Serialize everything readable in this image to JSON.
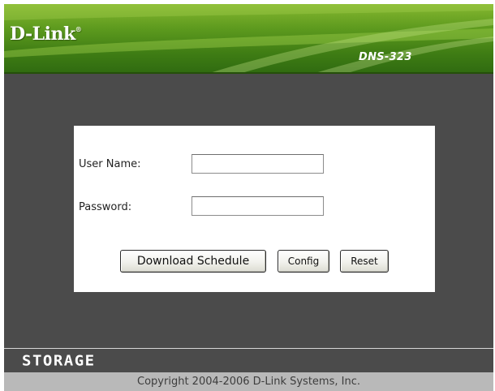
{
  "header": {
    "logo": "D-Link",
    "logo_mark": "®",
    "model": "DNS-323"
  },
  "login": {
    "username_label": "User Name:",
    "username_value": "",
    "password_label": "Password:",
    "password_value": "",
    "buttons": {
      "download_schedule": "Download Schedule",
      "config": "Config",
      "reset": "Reset"
    }
  },
  "footer": {
    "brand": "STORAGE",
    "copyright": "Copyright 2004-2006 D-Link Systems, Inc."
  },
  "colors": {
    "header_green": "#5d9a1e",
    "body_gray": "#4b4b4b",
    "copyright_bar": "#b9b9b9",
    "panel": "#ffffff"
  }
}
